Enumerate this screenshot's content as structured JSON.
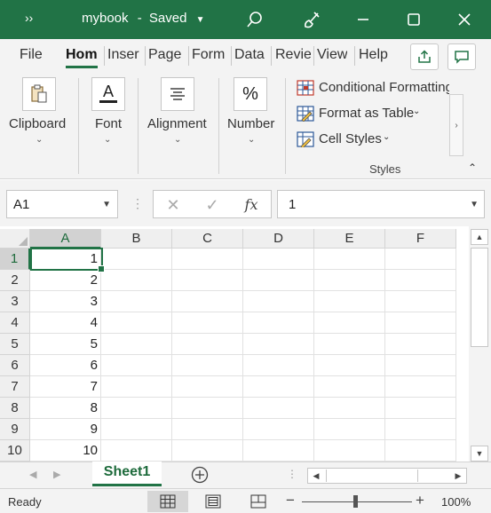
{
  "titlebar": {
    "quick_access": "››",
    "filename": "mybook",
    "separator": "-",
    "status": "Saved"
  },
  "tabs": [
    "File",
    "Hom",
    "Inser",
    "Page",
    "Form",
    "Data",
    "Revie",
    "View",
    "Help"
  ],
  "active_tab": "Hom",
  "ribbon": {
    "clipboard": "Clipboard",
    "font": "Font",
    "alignment": "Alignment",
    "number": "Number",
    "number_icon": "%",
    "font_icon": "A",
    "conditional_formatting": "Conditional Formatting",
    "format_as_table": "Format as Table",
    "cell_styles": "Cell Styles",
    "styles_group": "Styles"
  },
  "formula_bar": {
    "name_box": "A1",
    "function_icon": "fx",
    "value": "1"
  },
  "grid": {
    "columns": [
      "A",
      "B",
      "C",
      "D",
      "E",
      "F"
    ],
    "rows": [
      "1",
      "2",
      "3",
      "4",
      "5",
      "6",
      "7",
      "8",
      "9",
      "10"
    ],
    "column_a_values": [
      "1",
      "2",
      "3",
      "4",
      "5",
      "6",
      "7",
      "8",
      "9",
      "10"
    ],
    "selected_cell": "A1"
  },
  "sheets": {
    "tabs": [
      "Sheet1"
    ],
    "active": "Sheet1"
  },
  "status_bar": {
    "ready": "Ready",
    "zoom": "100%",
    "zoom_level_percent": 100
  },
  "colors": {
    "accent": "#217346",
    "ribbon_bg": "#f3f3f3"
  }
}
